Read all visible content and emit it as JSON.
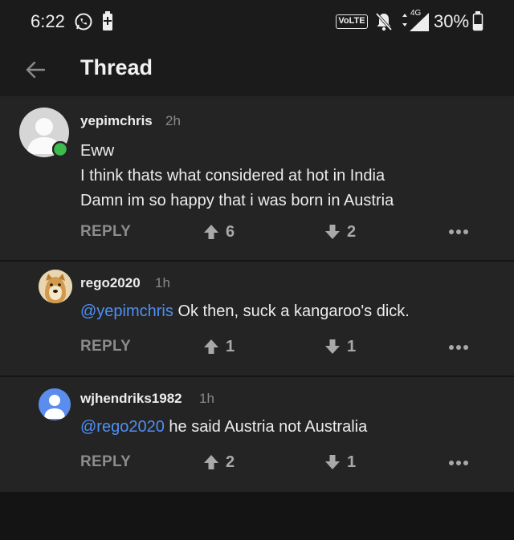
{
  "status_bar": {
    "time": "6:22",
    "network_badge": "VoLTE",
    "network_type": "4G",
    "battery": "30%"
  },
  "app_bar": {
    "title": "Thread"
  },
  "comments": [
    {
      "username": "yepimchris",
      "age": "2h",
      "online": true,
      "lines": [
        "Eww",
        "I think thats what considered at hot in India",
        "Damn im so happy that i was born in Austria"
      ],
      "reply_label": "REPLY",
      "upvotes": "6",
      "downvotes": "2"
    },
    {
      "username": "rego2020",
      "age": "1h",
      "mention": "@yepimchris",
      "text": " Ok then, suck a kangaroo's dick.",
      "reply_label": "REPLY",
      "upvotes": "1",
      "downvotes": "1"
    },
    {
      "username": "wjhendriks1982",
      "age": "1h",
      "mention": "@rego2020",
      "text": " he said Austria not Australia",
      "reply_label": "REPLY",
      "upvotes": "2",
      "downvotes": "1"
    }
  ],
  "colors": {
    "background": "#242424",
    "mention": "#4f8ff5",
    "online_dot": "#3dbb4f",
    "default_avatar": "#5b8def"
  }
}
